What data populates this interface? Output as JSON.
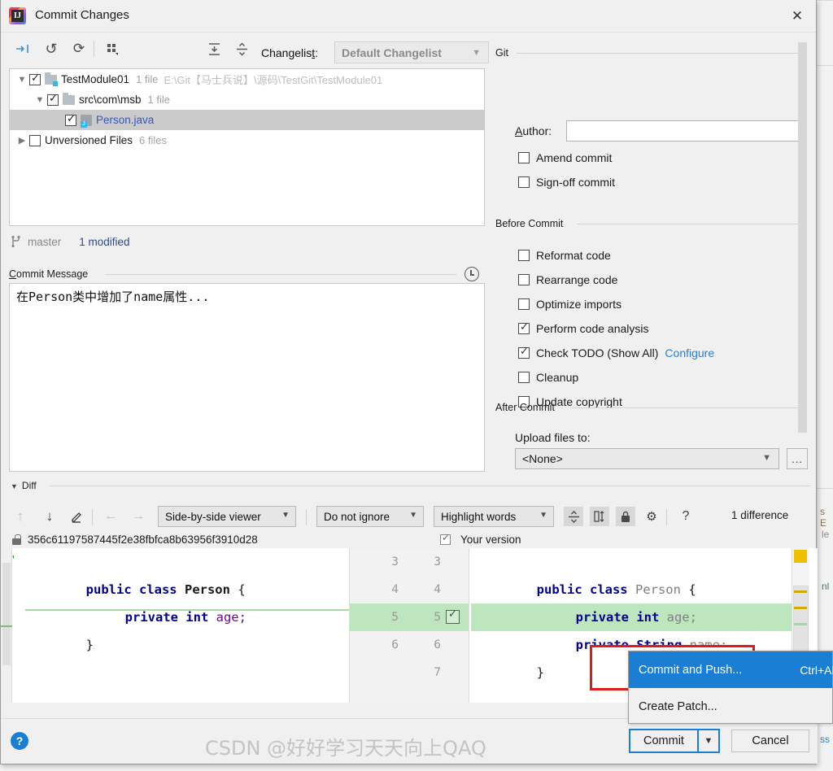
{
  "window": {
    "title": "Commit Changes",
    "app_icon": "intellij-idea-icon",
    "close_icon": "close-icon"
  },
  "toolbar": {
    "icons": [
      {
        "name": "collapse-to-changes-icon",
        "glyph": "⇥"
      },
      {
        "name": "rollback-icon",
        "glyph": "↺"
      },
      {
        "name": "refresh-icon",
        "glyph": "⟳"
      },
      {
        "name": "group-by-icon",
        "glyph": "▦"
      },
      {
        "name": "expand-all-icon",
        "glyph": "⤓"
      },
      {
        "name": "collapse-all-icon",
        "glyph": "⤒"
      }
    ],
    "changelist_label": "Changelist:",
    "changelist_value": "Default Changelist"
  },
  "file_tree": [
    {
      "name": "TestModule01",
      "meta": "1 file",
      "path": "E:\\Git【马士兵说】\\源码\\TestGit\\TestModule01",
      "checked": true,
      "expanded": true,
      "icon": "module-folder-icon",
      "indent": 0,
      "selected": false,
      "type": "module"
    },
    {
      "name": "src\\com\\msb",
      "meta": "1 file",
      "path": "",
      "checked": true,
      "expanded": true,
      "icon": "folder-icon",
      "indent": 1,
      "selected": false,
      "type": "folder"
    },
    {
      "name": "Person.java",
      "meta": "",
      "path": "",
      "checked": true,
      "expanded": null,
      "icon": "java-file-icon",
      "indent": 2,
      "selected": true,
      "type": "java"
    },
    {
      "name": "Unversioned Files",
      "meta": "6 files",
      "path": "",
      "checked": false,
      "expanded": false,
      "icon": "",
      "indent": 0,
      "selected": false,
      "type": "group"
    }
  ],
  "branch": {
    "icon": "git-branch-icon",
    "name": "master",
    "modified": "1 modified"
  },
  "commit_message": {
    "label": "Commit Message",
    "history_icon": "clock-history-icon",
    "value": "在Person类中增加了name属性..."
  },
  "git_section": {
    "title": "Git",
    "author_label": "Author:",
    "author_value": "",
    "checkboxes": [
      {
        "label": "Amend commit",
        "checked": false,
        "mnemonic": "m"
      },
      {
        "label": "Sign-off commit",
        "checked": false,
        "mnemonic": "g"
      }
    ]
  },
  "before_commit": {
    "title": "Before Commit",
    "checkboxes": [
      {
        "label": "Reformat code",
        "checked": false,
        "mnemonic": "R"
      },
      {
        "label": "Rearrange code",
        "checked": false,
        "mnemonic": "n"
      },
      {
        "label": "Optimize imports",
        "checked": false,
        "mnemonic": "O"
      },
      {
        "label": "Perform code analysis",
        "checked": true,
        "mnemonic": "s"
      },
      {
        "label": "Check TODO (Show All)",
        "checked": true,
        "mnemonic": "",
        "link": "Configure"
      },
      {
        "label": "Cleanup",
        "checked": false,
        "mnemonic": "l"
      },
      {
        "label": "Update copyright",
        "checked": false,
        "mnemonic": ""
      }
    ]
  },
  "after_commit": {
    "title": "After Commit",
    "upload_label": "Upload files to:",
    "upload_value": "<None>",
    "browse_label": "..."
  },
  "diff": {
    "section_label": "Diff",
    "icons": [
      {
        "name": "previous-difference-icon",
        "glyph": "↑",
        "state": "disabled"
      },
      {
        "name": "next-difference-icon",
        "glyph": "↓",
        "state": "enabled"
      },
      {
        "name": "edit-source-icon",
        "glyph": "✎",
        "state": "enabled"
      },
      {
        "name": "apply-left-icon",
        "glyph": "←",
        "state": "disabled"
      },
      {
        "name": "apply-right-icon",
        "glyph": "→",
        "state": "disabled"
      }
    ],
    "viewer_mode": "Side-by-side viewer",
    "ignore_mode": "Do not ignore",
    "highlight_mode": "Highlight words",
    "right_icons": [
      {
        "name": "collapse-unchanged-icon",
        "glyph": "⤒",
        "state": "toggled"
      },
      {
        "name": "synchronize-scroll-icon",
        "glyph": "◫",
        "state": "toggled"
      },
      {
        "name": "read-only-lock-icon",
        "glyph": "🔒",
        "state": "toggled"
      },
      {
        "name": "diff-settings-gear-icon",
        "glyph": "⚙",
        "state": "enabled"
      },
      {
        "name": "help-question-icon",
        "glyph": "?",
        "state": "enabled"
      }
    ],
    "difference_count": "1 difference",
    "left_hash": "356c61197587445f2e38fbfca8b63956f3910d28",
    "left_lock_icon": "lock-icon",
    "right_version_label": "Your version",
    "right_version_checked": true,
    "left_code": [
      {
        "num": "3",
        "tokens": [
          {
            "t": "public ",
            "c": "kw"
          },
          {
            "t": "class ",
            "c": "kw"
          },
          {
            "t": "Person",
            "c": "cls"
          },
          {
            "t": " {",
            "c": "pln"
          }
        ],
        "indent": 0
      },
      {
        "num": "4",
        "tokens": [
          {
            "t": "private ",
            "c": "kw"
          },
          {
            "t": "int ",
            "c": "kw"
          },
          {
            "t": "age;",
            "c": "fld"
          }
        ],
        "indent": 1
      },
      {
        "num": "5",
        "tokens": [
          {
            "t": "}",
            "c": "pln"
          }
        ],
        "indent": 0
      }
    ],
    "right_code": [
      {
        "num_old": "3",
        "num_new": "3",
        "tokens": [
          {
            "t": "public ",
            "c": "kw"
          },
          {
            "t": "class ",
            "c": "kw"
          },
          {
            "t": "Person",
            "c": "cls-gray"
          },
          {
            "t": " {",
            "c": "pln"
          }
        ],
        "indent": 0,
        "added": false,
        "accept": false
      },
      {
        "num_old": "4",
        "num_new": "4",
        "tokens": [
          {
            "t": "private ",
            "c": "kw"
          },
          {
            "t": "int ",
            "c": "kw"
          },
          {
            "t": "age;",
            "c": "fld-gray"
          }
        ],
        "indent": 1,
        "added": false,
        "accept": false
      },
      {
        "num_old": "5",
        "num_new": "5",
        "tokens": [
          {
            "t": "private ",
            "c": "kw"
          },
          {
            "t": "String ",
            "c": "kw"
          },
          {
            "t": "name;",
            "c": "fld-gray"
          }
        ],
        "indent": 1,
        "added": true,
        "accept": true
      },
      {
        "num_old": "6",
        "num_new": "6",
        "tokens": [
          {
            "t": "}",
            "c": "pln"
          }
        ],
        "indent": 0,
        "added": false,
        "accept": false
      },
      {
        "num_old": "",
        "num_new": "7",
        "tokens": [],
        "indent": 0,
        "added": false,
        "accept": false
      }
    ]
  },
  "popup_menu": {
    "items": [
      {
        "label": "Commit and Push...",
        "accel": "Ctrl+Alt+K",
        "selected": true,
        "mnemonic": "P"
      },
      {
        "label": "Create Patch...",
        "accel": "",
        "selected": false,
        "mnemonic": ""
      }
    ]
  },
  "bottom": {
    "help_icon": "help-icon",
    "help_glyph": "?",
    "commit_label": "Commit",
    "commit_dropdown_icon": "chevron-down-icon",
    "cancel_label": "Cancel"
  },
  "watermark": "CSDN @好好学习天天向上QAQ",
  "background": {
    "fragments": [
      "s E",
      "le",
      "nl",
      "ss"
    ]
  },
  "colors": {
    "accent_blue": "#1a7fd4",
    "link_blue": "#2a7fd4",
    "selection_gray": "#cbcbcb",
    "added_green": "#bee6be",
    "red_highlight": "#e01b1b",
    "dialog_bg": "#f0f0f0"
  }
}
